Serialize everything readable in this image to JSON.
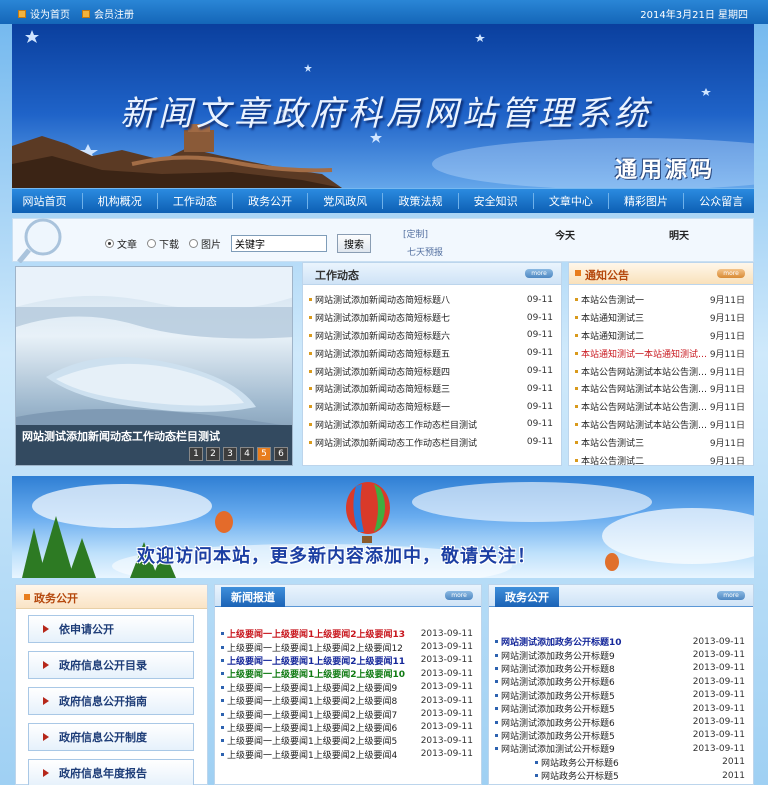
{
  "topbar": {
    "set_home": "设为首页",
    "register": "会员注册",
    "date": "2014年3月21日  星期四"
  },
  "banner": {
    "title": "新闻文章政府科局网站管理系统",
    "stamp": "通用源码"
  },
  "nav": [
    "网站首页",
    "机构概况",
    "工作动态",
    "政务公开",
    "党风政风",
    "政策法规",
    "安全知识",
    "文章中心",
    "精彩图片",
    "公众留言"
  ],
  "search": {
    "options": [
      "文章",
      "下载",
      "图片"
    ],
    "selected": "文章",
    "keyword": "关键字",
    "button": "搜索"
  },
  "weather": {
    "custom": "[定制]",
    "seven_day": "七天预报",
    "today": "今天",
    "tomorrow": "明天"
  },
  "slideshow": {
    "caption": "网站测试添加新闻动态工作动态栏目测试",
    "pages": [
      "1",
      "2",
      "3",
      "4",
      "5",
      "6"
    ],
    "active_page": "5"
  },
  "work_news": {
    "title": "工作动态",
    "more": "more",
    "items": [
      {
        "title": "网站测试添加新闻动态简短标题八",
        "date": "09-11"
      },
      {
        "title": "网站测试添加新闻动态简短标题七",
        "date": "09-11"
      },
      {
        "title": "网站测试添加新闻动态简短标题六",
        "date": "09-11"
      },
      {
        "title": "网站测试添加新闻动态简短标题五",
        "date": "09-11"
      },
      {
        "title": "网站测试添加新闻动态简短标题四",
        "date": "09-11"
      },
      {
        "title": "网站测试添加新闻动态简短标题三",
        "date": "09-11"
      },
      {
        "title": "网站测试添加新闻动态简短标题一",
        "date": "09-11"
      },
      {
        "title": "网站测试添加新闻动态工作动态栏目测试",
        "date": "09-11"
      },
      {
        "title": "网站测试添加新闻动态工作动态栏目测试",
        "date": "09-11"
      }
    ]
  },
  "notice": {
    "title": "通知公告",
    "more": "more",
    "items": [
      {
        "title": "本站公告测试一",
        "date": "9月11日"
      },
      {
        "title": "本站通知测试三",
        "date": "9月11日"
      },
      {
        "title": "本站通知测试二",
        "date": "9月11日"
      },
      {
        "title": "本站通知测试一本站通知测试…",
        "date": "9月11日",
        "highlight": true
      },
      {
        "title": "本站公告网站测试本站公告测…",
        "date": "9月11日"
      },
      {
        "title": "本站公告网站测试本站公告测…",
        "date": "9月11日"
      },
      {
        "title": "本站公告网站测试本站公告测…",
        "date": "9月11日"
      },
      {
        "title": "本站公告网站测试本站公告测…",
        "date": "9月11日"
      },
      {
        "title": "本站公告测试三",
        "date": "9月11日"
      },
      {
        "title": "本站公告测试二",
        "date": "9月11日"
      }
    ]
  },
  "ad": {
    "text": "欢迎访问本站，更多新内容添加中，敬请关注！"
  },
  "gov_open": {
    "title": "政务公开",
    "buttons": [
      "依申请公开",
      "政府信息公开目录",
      "政府信息公开指南",
      "政府信息公开制度",
      "政府信息年度报告"
    ]
  },
  "news_report": {
    "tab": "新闻报道",
    "more": "more",
    "items": [
      {
        "title": "上级要闻一上级要闻1上级要闻2上级要闻13",
        "date": "2013-09-11",
        "style": "red"
      },
      {
        "title": "上级要闻一上级要闻1上级要闻2上级要闻12",
        "date": "2013-09-11",
        "style": "plain"
      },
      {
        "title": "上级要闻一上级要闻1上级要闻2上级要闻11",
        "date": "2013-09-11",
        "style": "navy"
      },
      {
        "title": "上级要闻一上级要闻1上级要闻2上级要闻10",
        "date": "2013-09-11",
        "style": "green"
      },
      {
        "title": "上级要闻一上级要闻1上级要闻2上级要闻9",
        "date": "2013-09-11",
        "style": "plain"
      },
      {
        "title": "上级要闻一上级要闻1上级要闻2上级要闻8",
        "date": "2013-09-11",
        "style": "plain"
      },
      {
        "title": "上级要闻一上级要闻1上级要闻2上级要闻7",
        "date": "2013-09-11",
        "style": "plain"
      },
      {
        "title": "上级要闻一上级要闻1上级要闻2上级要闻6",
        "date": "2013-09-11",
        "style": "plain"
      },
      {
        "title": "上级要闻一上级要闻1上级要闻2上级要闻5",
        "date": "2013-09-11",
        "style": "plain"
      },
      {
        "title": "上级要闻一上级要闻1上级要闻2上级要闻4",
        "date": "2013-09-11",
        "style": "plain"
      }
    ]
  },
  "gov_public": {
    "tab": "政务公开",
    "more": "more",
    "items": [
      {
        "title": "网站测试添加政务公开标题10",
        "date": "2013-09-11",
        "style": "navy"
      },
      {
        "title": "网站测试添加政务公开标题9",
        "date": "2013-09-11",
        "style": "plain"
      },
      {
        "title": "网站测试添加政务公开标题8",
        "date": "2013-09-11",
        "style": "plain"
      },
      {
        "title": "网站测试添加政务公开标题6",
        "date": "2013-09-11",
        "style": "plain"
      },
      {
        "title": "网站测试添加政务公开标题5",
        "date": "2013-09-11",
        "style": "plain"
      },
      {
        "title": "网站测试添加政务公开标题5",
        "date": "2013-09-11",
        "style": "plain"
      },
      {
        "title": "网站测试添加政务公开标题6",
        "date": "2013-09-11",
        "style": "plain"
      },
      {
        "title": "网站测试添加政务公开标题5",
        "date": "2013-09-11",
        "style": "plain"
      },
      {
        "title": "网站测试添加测试公开标题9",
        "date": "2013-09-11",
        "style": "plain"
      },
      {
        "title": "网站政务公开标题6",
        "date": "2011",
        "style": "sub"
      },
      {
        "title": "网站政务公开标题5",
        "date": "2011",
        "style": "sub"
      }
    ]
  }
}
